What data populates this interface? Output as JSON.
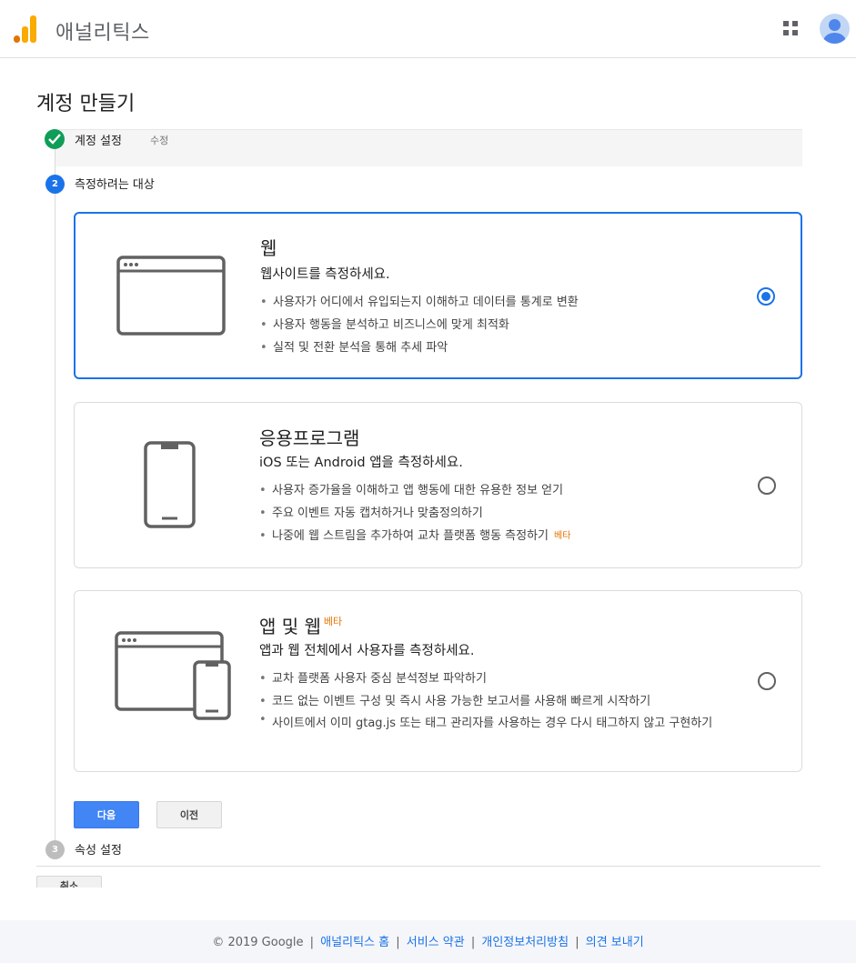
{
  "header": {
    "app_title": "애널리틱스",
    "logo_icon": "analytics-logo-icon",
    "apps_icon": "apps-grid-icon",
    "avatar_icon": "account-avatar-icon"
  },
  "page": {
    "title": "계정 만들기"
  },
  "steps": [
    {
      "number": "",
      "label": "계정 설정",
      "status": "done",
      "edit_label": "수정"
    },
    {
      "number": "2",
      "label": "측정하려는 대상",
      "status": "active"
    },
    {
      "number": "3",
      "label": "속성 설정",
      "status": "pending"
    }
  ],
  "cards": [
    {
      "title": "웹",
      "subtitle": "웹사이트를 측정하세요.",
      "icon": "browser-window-icon",
      "bullets": [
        "사용자가 어디에서 유입되는지 이해하고 데이터를 통계로 변환",
        "사용자 행동을 분석하고 비즈니스에 맞게 최적화",
        "실적 및 전환 분석을 통해 추세 파악"
      ],
      "selected": true
    },
    {
      "title": "응용프로그램",
      "subtitle": "iOS 또는 Android 앱을 측정하세요.",
      "icon": "smartphone-icon",
      "bullets": [
        "사용자 증가율을 이해하고 앱 행동에 대한 유용한 정보 얻기",
        "주요 이벤트 자동 캡처하거나 맞춤정의하기",
        "나중에 웹 스트림을 추가하여 교차 플랫폼 행동 측정하기"
      ],
      "beta_label": "베타",
      "selected": false
    },
    {
      "title": "앱 및 웹",
      "title_badge": "베타",
      "subtitle": "앱과 웹 전체에서 사용자를 측정하세요.",
      "icon": "browser-and-phone-icon",
      "bullets": [
        "교차 플랫폼 사용자 중심 분석정보 파악하기",
        "코드 없는 이벤트 구성 및 즉시 사용 가능한 보고서를 사용해 빠르게 시작하기",
        "사이트에서 이미 gtag.js 또는 태그 관리자를 사용하는 경우 다시 태그하지 않고 구현하기"
      ],
      "selected": false
    }
  ],
  "buttons": {
    "next": "다음",
    "previous": "이전",
    "cancel": "취소"
  },
  "footer": {
    "copyright": "© 2019 Google",
    "links": [
      "애널리틱스 홈",
      "서비스 약관",
      "개인정보처리방침",
      "의견 보내기"
    ],
    "separator": "|"
  },
  "colors": {
    "accent": "#1a73e8",
    "button_primary": "#4285f4",
    "success": "#0f9d58",
    "beta": "#e37400",
    "logo_orange": "#f9ab00"
  }
}
